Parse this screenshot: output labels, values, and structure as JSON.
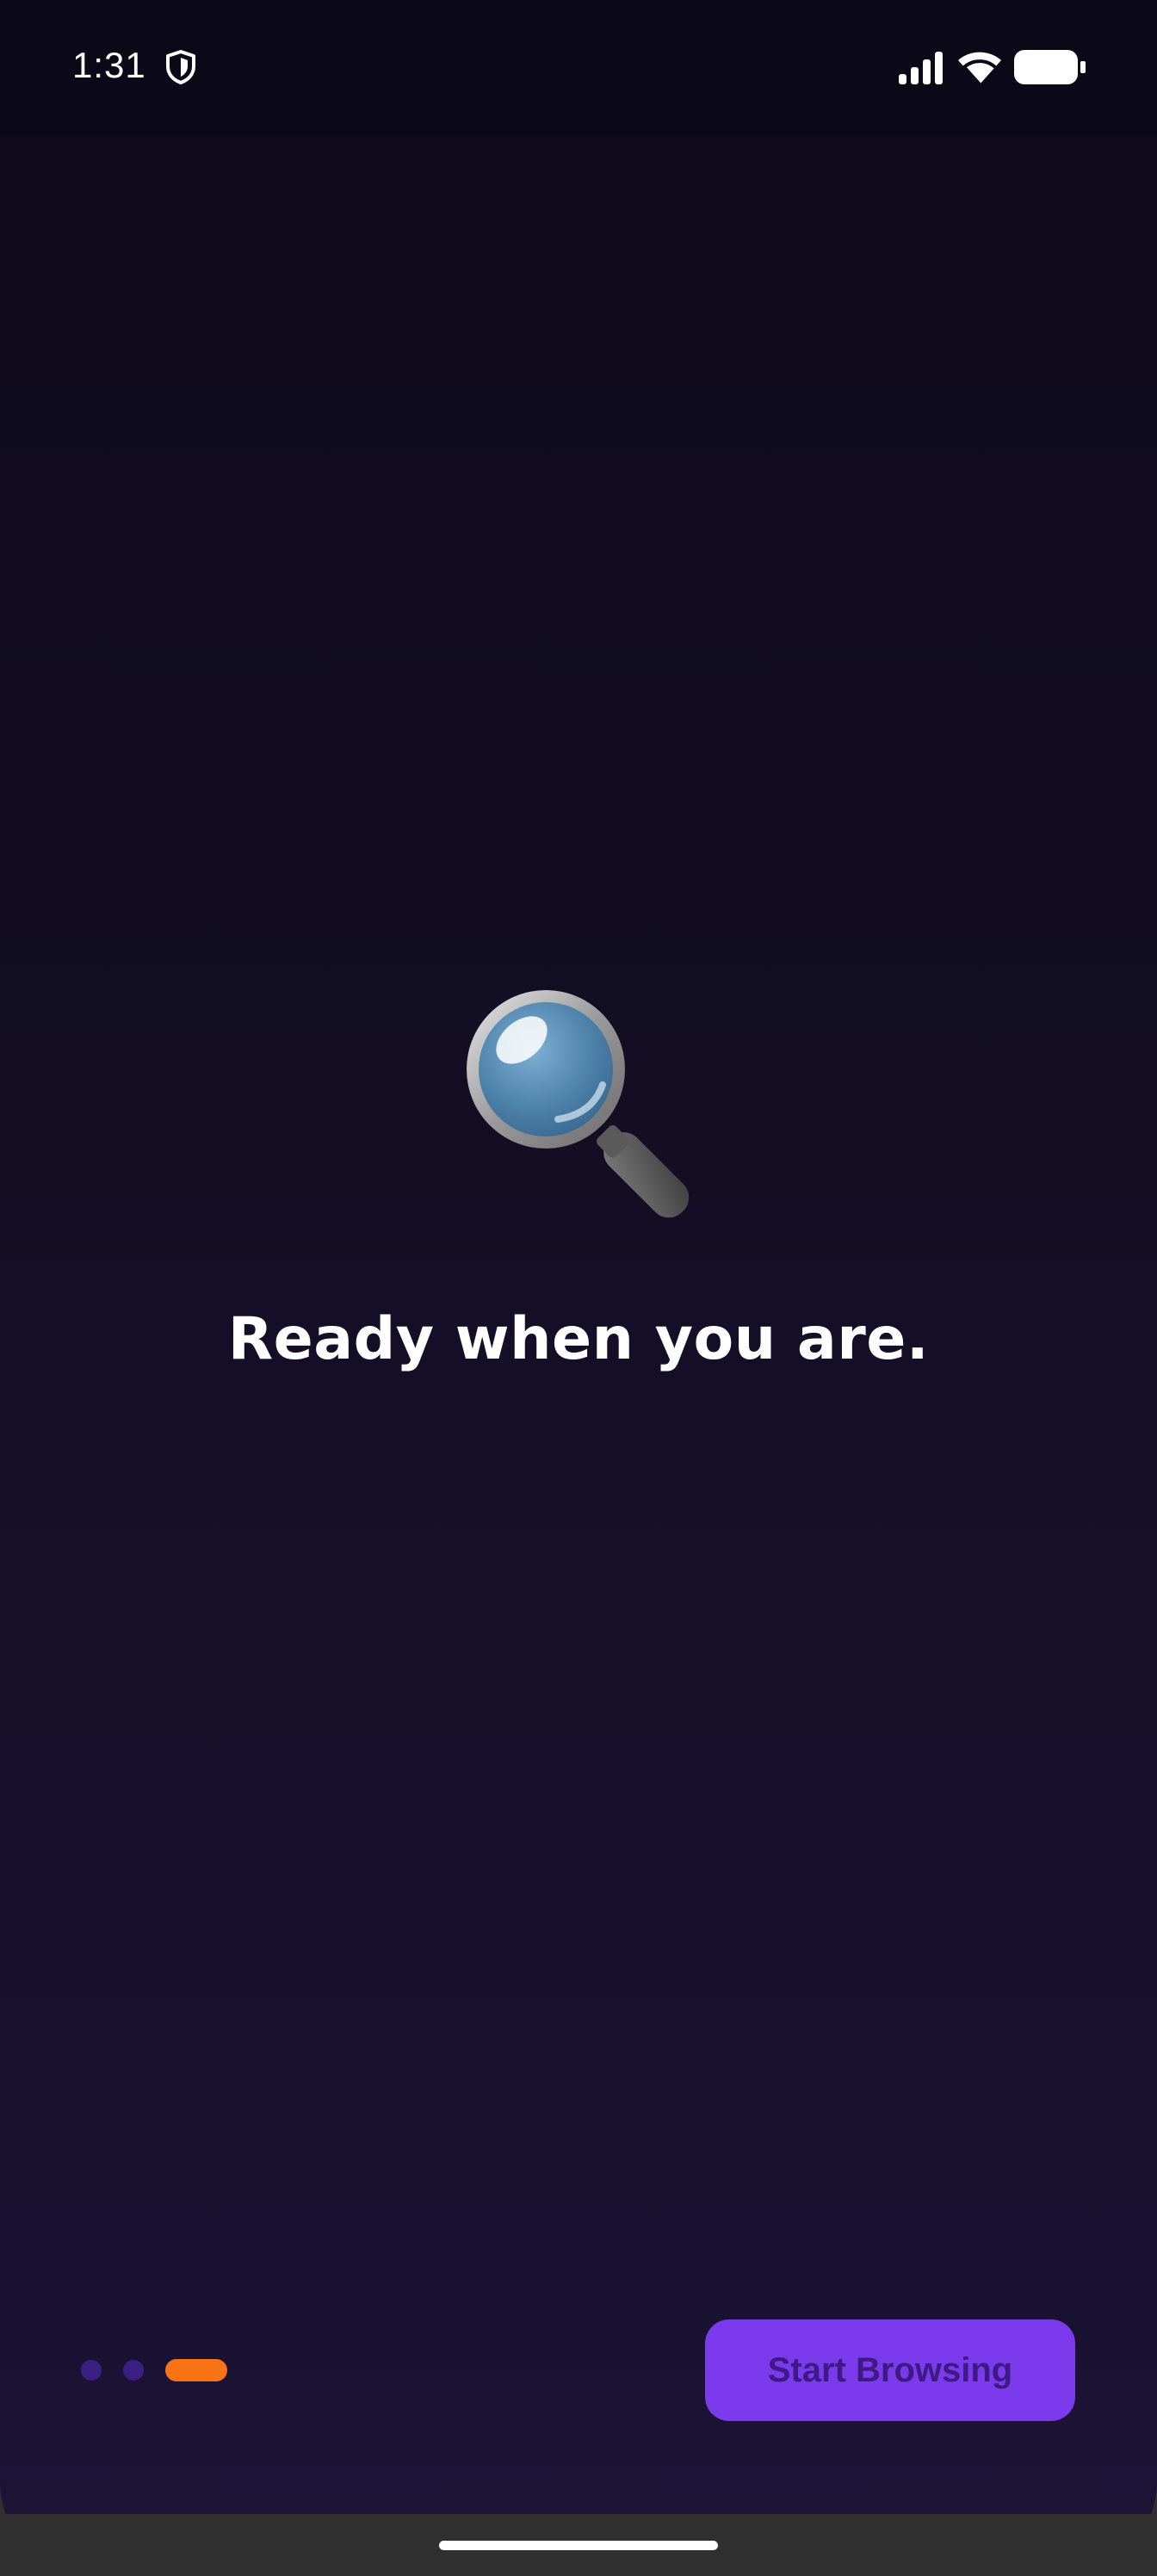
{
  "status_bar": {
    "time": "1:31",
    "icons": [
      "shield-icon",
      "signal-icon",
      "wifi-icon",
      "battery-icon"
    ]
  },
  "onboarding": {
    "illustration_icon": "magnifier-icon",
    "headline": "Ready when you are.",
    "page_indicator": {
      "total_pages": 3,
      "current_page": 3
    },
    "cta_label": "Start Browsing"
  },
  "colors": {
    "background_top": "#0f0b1c",
    "background_bottom": "#1c1336",
    "accent_purple": "#7c3aed",
    "button_text": "#3d1a84",
    "active_indicator": "#f97316",
    "inactive_indicator": "#3b1f82",
    "nav_bar": "#303030"
  }
}
